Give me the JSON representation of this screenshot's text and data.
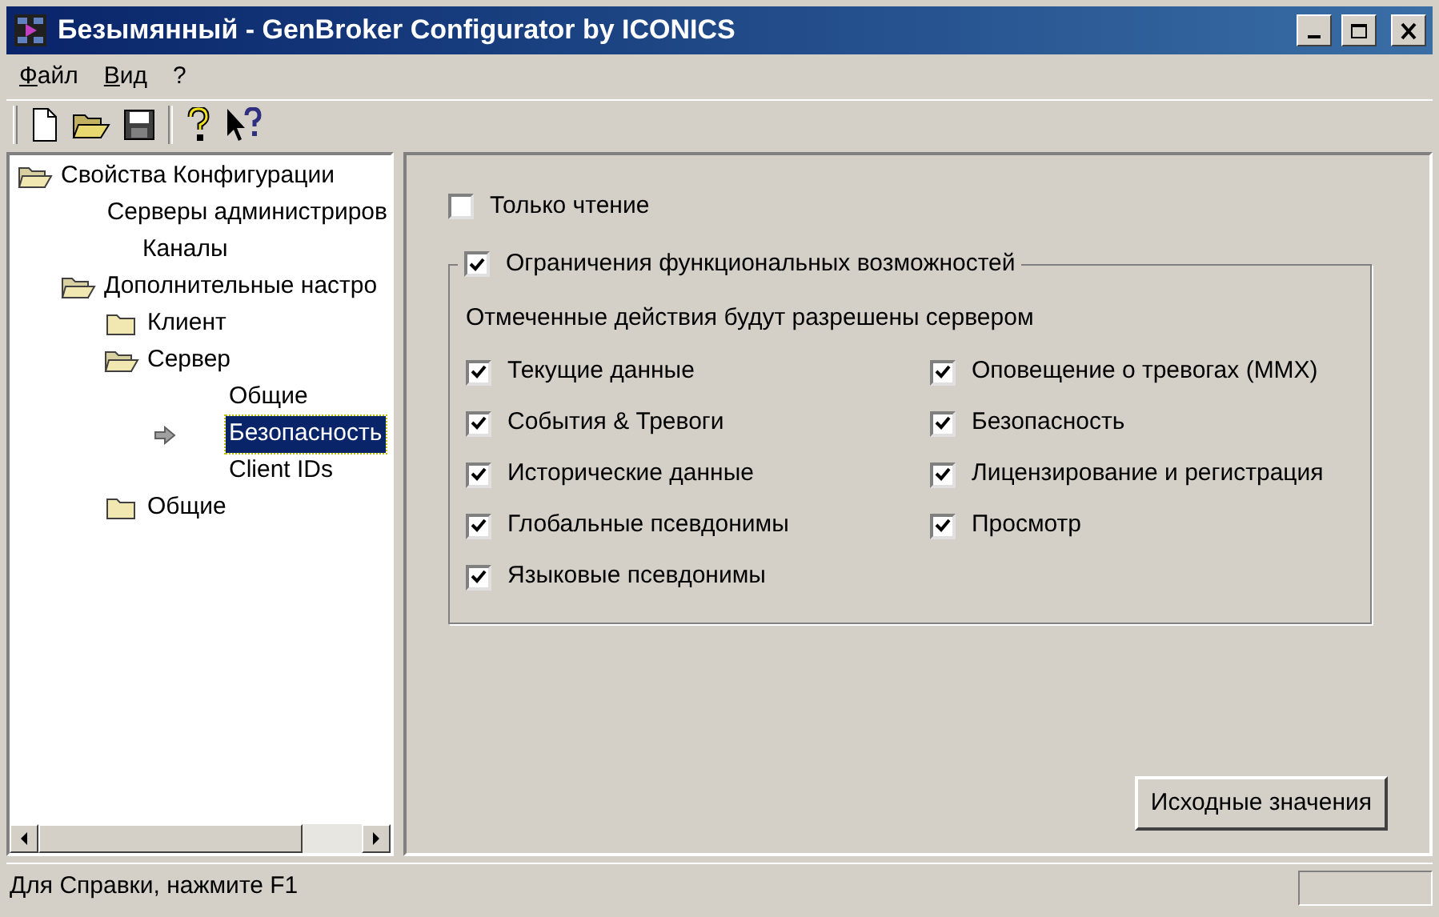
{
  "window": {
    "title": "Безымянный - GenBroker Configurator by ICONICS"
  },
  "menu": [
    "Файл",
    "Вид",
    "?"
  ],
  "tree": [
    {
      "label": "Свойства Конфигурации",
      "kind": "folder",
      "expanded": true,
      "selected": false,
      "children": [
        {
          "label": "Серверы администриров",
          "kind": "leaf",
          "selected": false
        },
        {
          "label": "Каналы",
          "kind": "leaf",
          "selected": false
        },
        {
          "label": "Дополнительные настро",
          "kind": "folder",
          "expanded": true,
          "selected": false,
          "children": [
            {
              "label": "Клиент",
              "kind": "folder",
              "expanded": false,
              "selected": false
            },
            {
              "label": "Сервер",
              "kind": "folder",
              "expanded": true,
              "selected": false,
              "children": [
                {
                  "label": "Общие",
                  "kind": "leaf",
                  "selected": false
                },
                {
                  "label": "Безопасность",
                  "kind": "leaf",
                  "selected": true
                },
                {
                  "label": "Client IDs",
                  "kind": "leaf",
                  "selected": false
                }
              ]
            },
            {
              "label": "Общие",
              "kind": "folder",
              "expanded": false,
              "selected": false
            }
          ]
        }
      ]
    }
  ],
  "read_only": {
    "label": "Только чтение",
    "checked": false
  },
  "restrictions": {
    "label": "Ограничения функциональных возможностей",
    "checked": true,
    "note": "Отмеченные действия будут разрешены сервером",
    "left": [
      {
        "label": "Текущие данные",
        "checked": true
      },
      {
        "label": "События & Тревоги",
        "checked": true
      },
      {
        "label": "Исторические данные",
        "checked": true
      },
      {
        "label": "Глобальные псевдонимы",
        "checked": true
      },
      {
        "label": "Языковые псевдонимы",
        "checked": true
      }
    ],
    "right": [
      {
        "label": "Оповещение о тревогах (MMX)",
        "checked": true
      },
      {
        "label": "Безопасность",
        "checked": true
      },
      {
        "label": "Лицензирование и регистрация",
        "checked": true
      },
      {
        "label": "Просмотр",
        "checked": true
      }
    ]
  },
  "defaults_button": "Исходные значения",
  "status_bar": "Для Справки, нажмите F1"
}
